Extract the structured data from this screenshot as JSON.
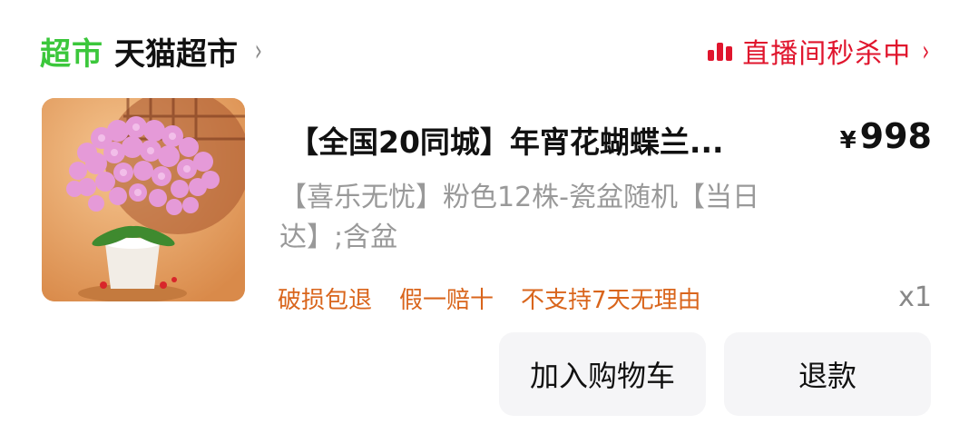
{
  "header": {
    "store_badge": "超市",
    "store_name": "天猫超市",
    "live_text": "直播间秒杀中",
    "chevron": "›",
    "live_color": "#e0152d",
    "badge_color": "#3bc73b"
  },
  "product": {
    "image_icon": "orchid-pot-image",
    "title": "【全国20同城】年宵花蝴蝶兰...",
    "price_currency": "¥",
    "price_value": "998",
    "spec": "【喜乐无忧】粉色12株-瓷盆随机【当日达】;含盆",
    "tags": [
      "破损包退",
      "假一赔十",
      "不支持7天无理由"
    ],
    "tag_color": "#d9651c",
    "quantity": "x1"
  },
  "actions": {
    "add_to_cart": "加入购物车",
    "refund": "退款"
  }
}
